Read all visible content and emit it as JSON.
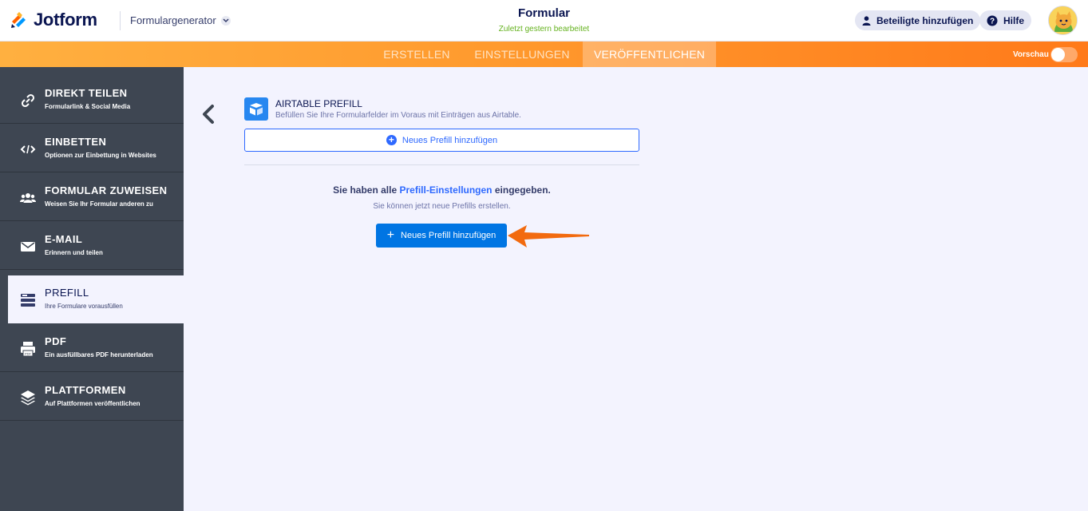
{
  "header": {
    "brand": "Jotform",
    "product_switch": "Formulargenerator",
    "form_title": "Formular",
    "form_subtitle": "Zuletzt gestern bearbeitet",
    "invite_label": "Beteiligte hinzufügen",
    "help_label": "Hilfe"
  },
  "nav": {
    "tabs": [
      {
        "label": "ERSTELLEN",
        "active": false
      },
      {
        "label": "EINSTELLUNGEN",
        "active": false
      },
      {
        "label": "VERÖFFENTLICHEN",
        "active": true
      }
    ],
    "preview_label": "Vorschau",
    "preview_on": false
  },
  "sidebar": {
    "items": [
      {
        "title": "DIREKT TEILEN",
        "desc": "Formularlink & Social Media",
        "icon": "link-icon",
        "active": false
      },
      {
        "title": "EINBETTEN",
        "desc": "Optionen zur Einbettung in Websites",
        "icon": "code-icon",
        "active": false
      },
      {
        "title": "FORMULAR ZUWEISEN",
        "desc": "Weisen Sie Ihr Formular anderen zu",
        "icon": "users-icon",
        "active": false
      },
      {
        "title": "E-MAIL",
        "desc": "Erinnern und teilen",
        "icon": "mail-icon",
        "active": false
      },
      {
        "title": "PREFILL",
        "desc": "Ihre Formulare vorausfüllen",
        "icon": "prefill-icon",
        "active": true
      },
      {
        "title": "PDF",
        "desc": "Ein ausfüllbares PDF herunterladen",
        "icon": "pdf-icon",
        "active": false
      },
      {
        "title": "PLATTFORMEN",
        "desc": "Auf Plattformen veröffentlichen",
        "icon": "layers-icon",
        "active": false
      }
    ]
  },
  "main": {
    "prefill_title": "AIRTABLE PREFILL",
    "prefill_desc": "Befüllen Sie Ihre Formularfelder im Voraus mit Einträgen aus Airtable.",
    "add_outline_label": "Neues Prefill hinzufügen",
    "done_prefix": "Sie haben alle",
    "done_link": "Prefill-Einstellungen",
    "done_suffix": "eingegeben.",
    "can_text": "Sie können jetzt neue Prefills erstellen.",
    "add_primary_label": "Neues Prefill hinzufügen"
  },
  "colors": {
    "accent": "#0075e3",
    "nav_orange": "#ff7a1a",
    "sidebar_bg": "#3e4652",
    "link_blue": "#2e69ff",
    "arrow_orange": "#f26a0f"
  }
}
